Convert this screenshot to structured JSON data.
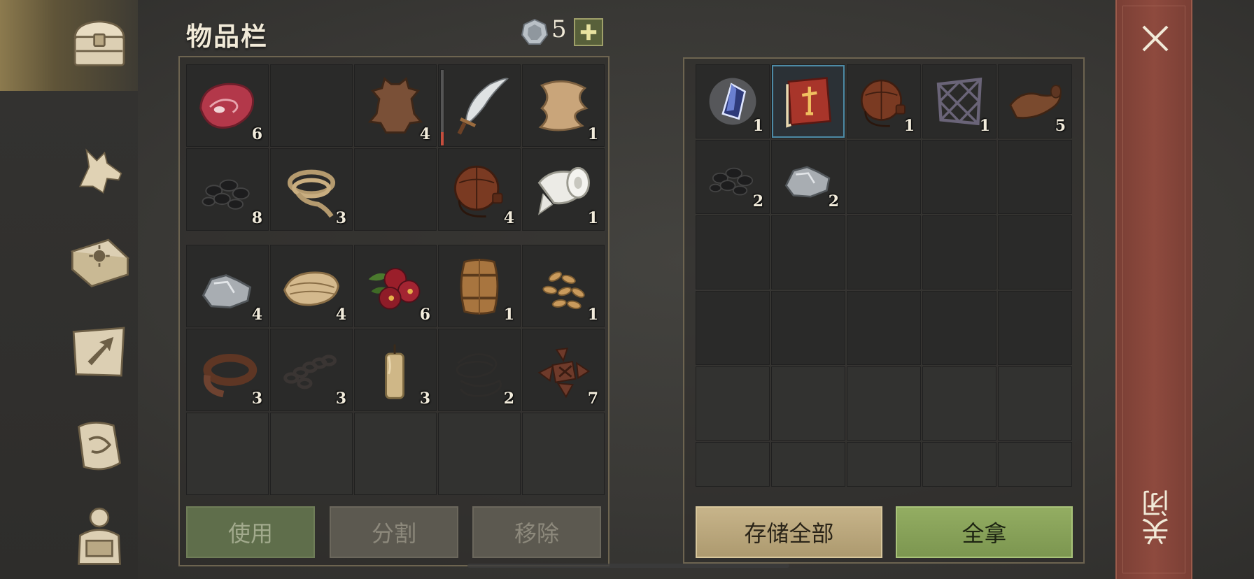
{
  "header": {
    "title": "物品栏",
    "currency_count": "5",
    "add_currency_icon": "plus-icon"
  },
  "nav": {
    "items": [
      {
        "icon": "chest-icon",
        "active": true
      },
      {
        "icon": "wolf-icon",
        "active": false
      },
      {
        "icon": "sun-book-icon",
        "active": false
      },
      {
        "icon": "crafting-map-icon",
        "active": false
      },
      {
        "icon": "quest-scroll-icon",
        "active": false
      },
      {
        "icon": "backpack-character-icon",
        "active": false
      }
    ]
  },
  "inventory": {
    "hotbar": [
      {
        "item": "raw-meat",
        "count": "6"
      },
      {
        "item": "empty",
        "count": ""
      },
      {
        "item": "animal-hide",
        "count": "4"
      },
      {
        "item": "scimitar",
        "count": "",
        "durability": 0.18
      },
      {
        "item": "cloth-scrap",
        "count": "1"
      },
      {
        "item": "coal",
        "count": "8"
      },
      {
        "item": "rope",
        "count": "3"
      },
      {
        "item": "empty",
        "count": ""
      },
      {
        "item": "leather-waterskin",
        "count": "4"
      },
      {
        "item": "bandage",
        "count": "1"
      }
    ],
    "backpack": [
      {
        "item": "iron-ore",
        "count": "4"
      },
      {
        "item": "cloth-roll",
        "count": "4"
      },
      {
        "item": "berries",
        "count": "6"
      },
      {
        "item": "barrel",
        "count": "1"
      },
      {
        "item": "seeds",
        "count": "1"
      },
      {
        "item": "leather-strip",
        "count": "3"
      },
      {
        "item": "chain",
        "count": "3"
      },
      {
        "item": "candle",
        "count": "3"
      },
      {
        "item": "wire",
        "count": "2"
      },
      {
        "item": "scrap-metal",
        "count": "7"
      },
      {
        "item": "empty",
        "count": ""
      },
      {
        "item": "empty",
        "count": ""
      },
      {
        "item": "empty",
        "count": ""
      },
      {
        "item": "empty",
        "count": ""
      },
      {
        "item": "empty",
        "count": ""
      }
    ],
    "buttons": {
      "use": "使用",
      "split": "分割",
      "remove": "移除"
    }
  },
  "storage": {
    "slots": [
      {
        "item": "crystal-shard",
        "count": "1"
      },
      {
        "item": "recipe-book",
        "count": "",
        "selected": true
      },
      {
        "item": "leather-waterskin",
        "count": "1"
      },
      {
        "item": "iron-grate",
        "count": "1"
      },
      {
        "item": "leather-roll",
        "count": "5"
      },
      {
        "item": "coal",
        "count": "2"
      },
      {
        "item": "iron-ore",
        "count": "2"
      }
    ],
    "buttons": {
      "store_all": "存储全部",
      "take_all": "全拿"
    }
  },
  "close": {
    "label": "关闭",
    "icon": "close-icon"
  },
  "colors": {
    "accent_green": "#93ad62",
    "accent_tan": "#c7b48a",
    "close_red": "#8e4a3e",
    "selected_blue": "#4d8aa5"
  }
}
